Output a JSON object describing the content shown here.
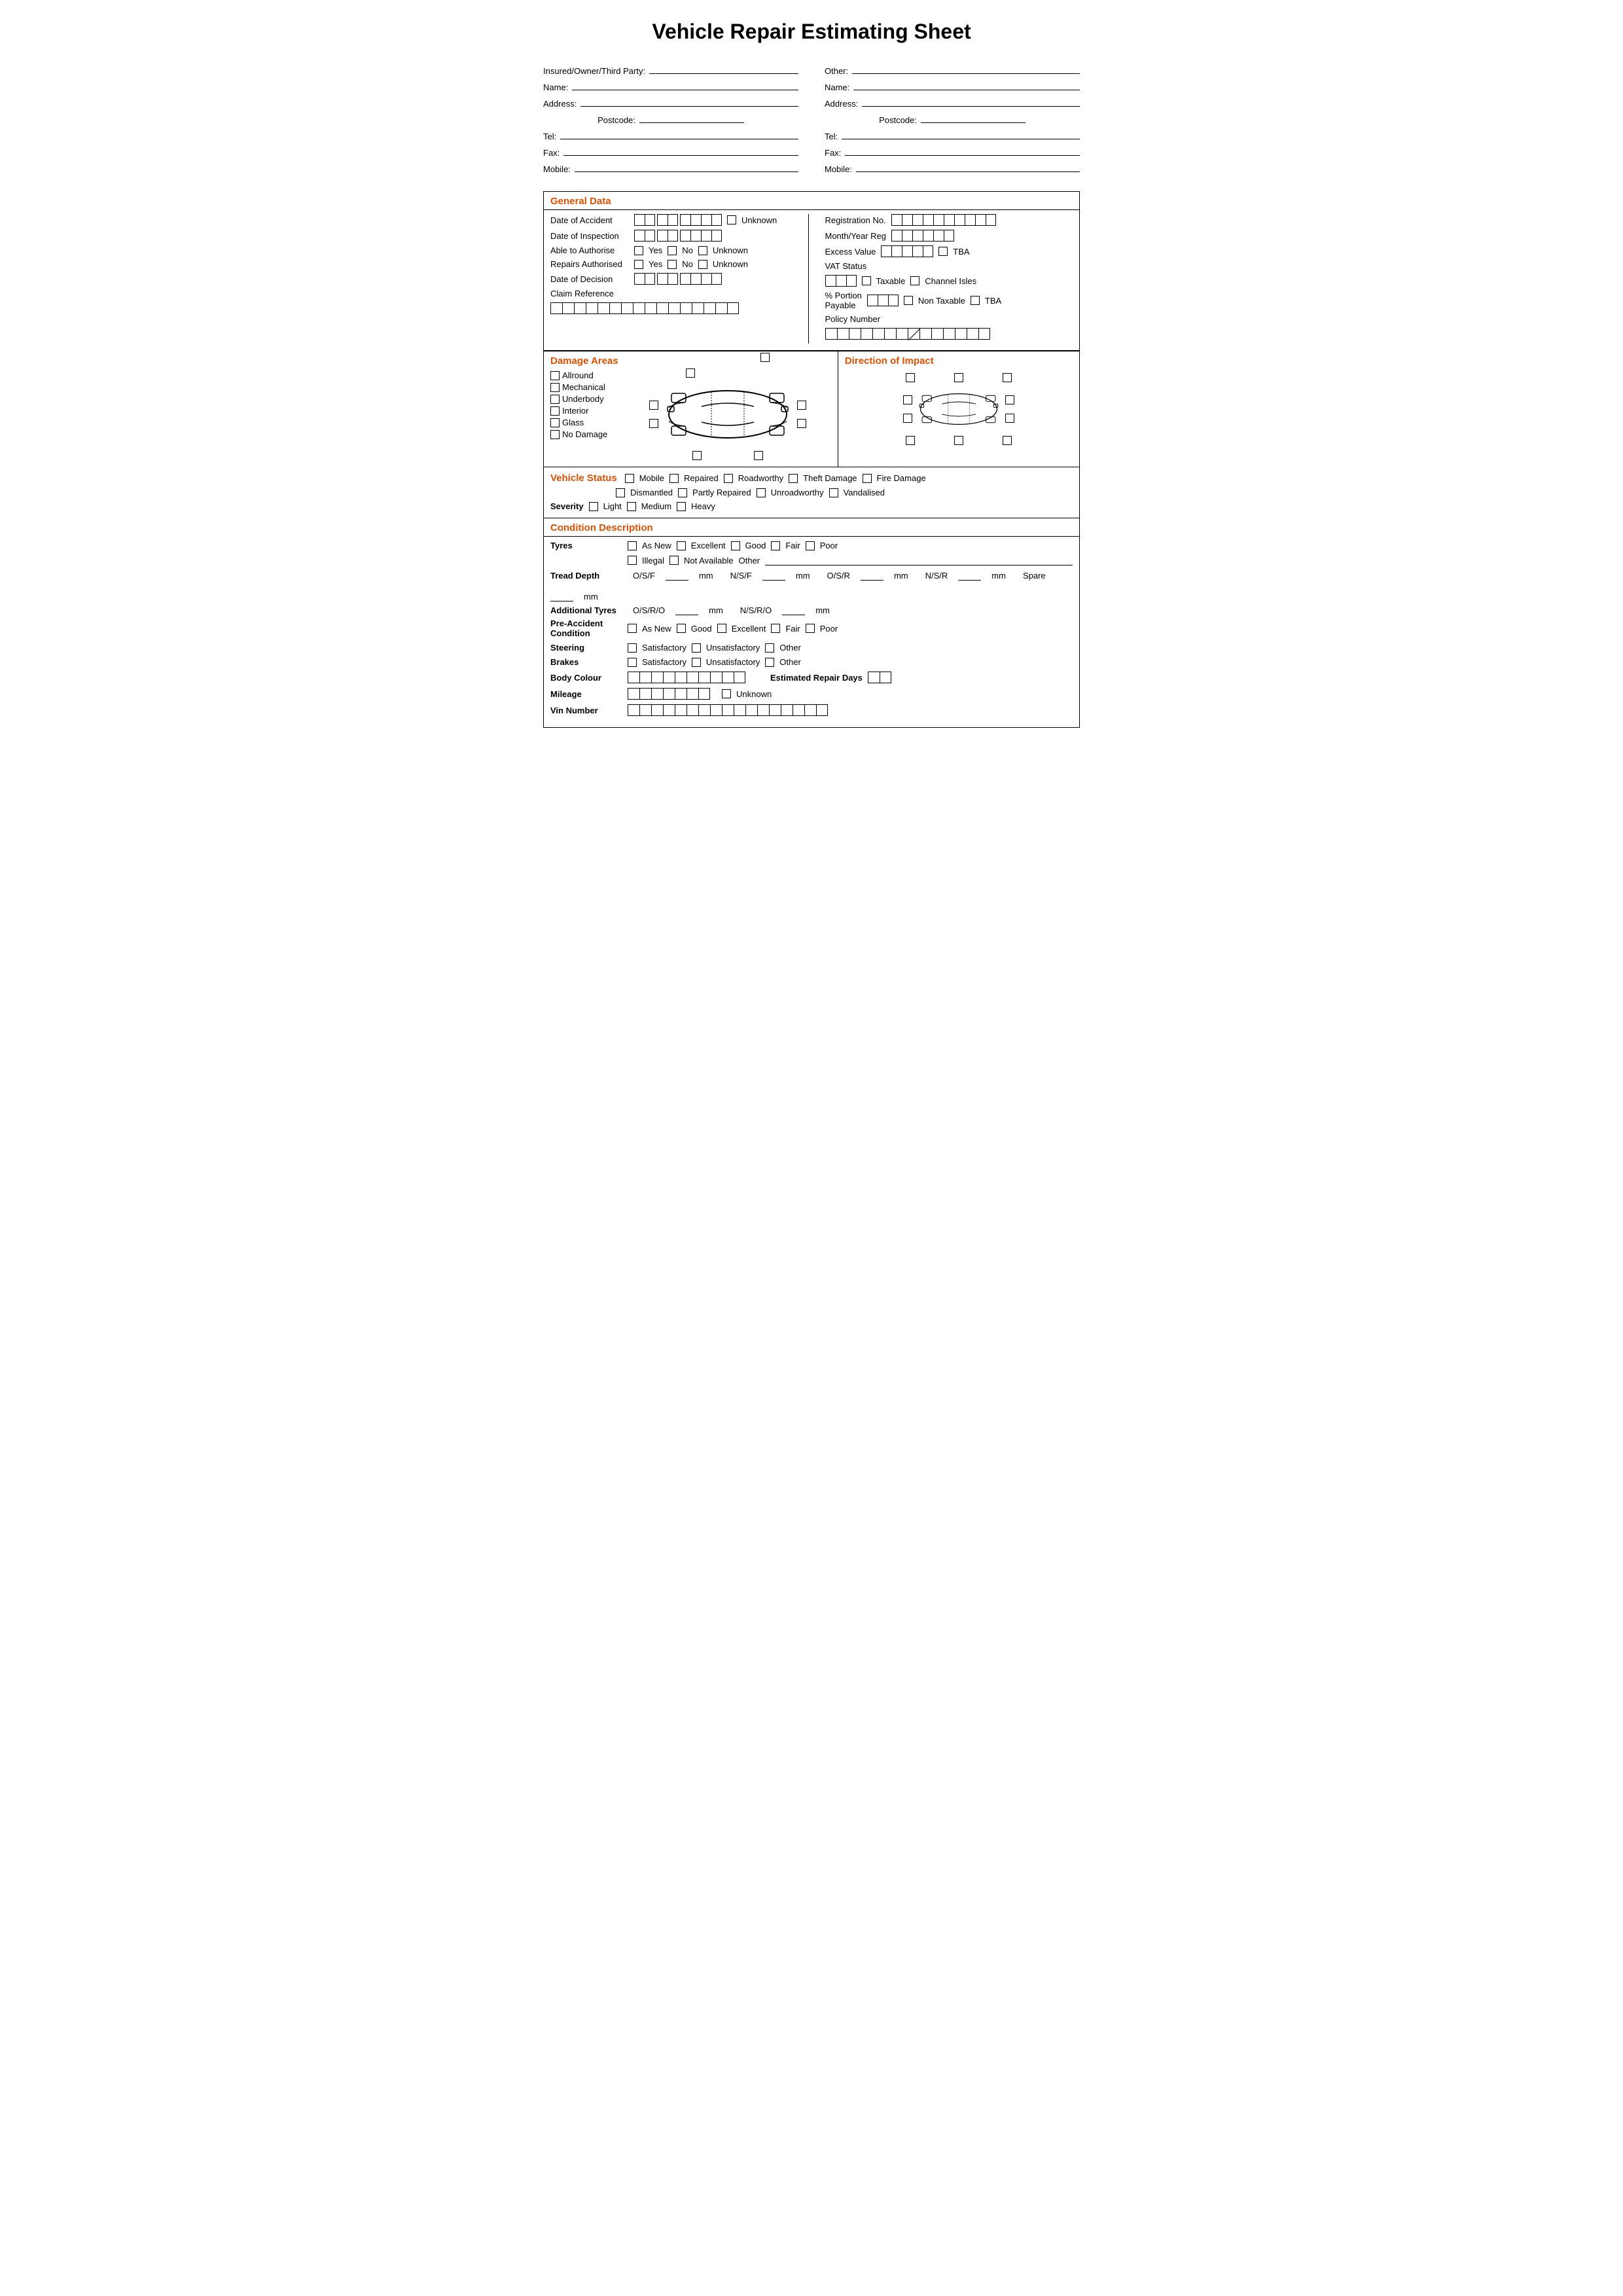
{
  "title": "Vehicle Repair Estimating Sheet",
  "left_column": {
    "label": "Insured/Owner/Third Party:",
    "fields": [
      {
        "label": "Name:",
        "id": "left-name"
      },
      {
        "label": "Address:",
        "id": "left-address"
      },
      {
        "label": "Postcode:",
        "id": "left-postcode"
      },
      {
        "label": "Tel:",
        "id": "left-tel"
      },
      {
        "label": "Fax:",
        "id": "left-fax"
      },
      {
        "label": "Mobile:",
        "id": "left-mobile"
      }
    ]
  },
  "right_column": {
    "label": "Other:",
    "fields": [
      {
        "label": "Name:",
        "id": "right-name"
      },
      {
        "label": "Address:",
        "id": "right-address"
      },
      {
        "label": "Postcode:",
        "id": "right-postcode"
      },
      {
        "label": "Tel:",
        "id": "right-tel"
      },
      {
        "label": "Fax:",
        "id": "right-fax"
      },
      {
        "label": "Mobile:",
        "id": "right-mobile"
      }
    ]
  },
  "sections": {
    "general_data": {
      "header": "General Data",
      "left": {
        "rows": [
          {
            "label": "Date of Accident",
            "boxes": 9,
            "extra": [
              {
                "type": "cb+label",
                "label": "Unknown"
              }
            ]
          },
          {
            "label": "Date of Inspection",
            "boxes": 7
          },
          {
            "label": "Able to Authorise",
            "options": [
              "Yes",
              "No",
              "Unknown"
            ]
          },
          {
            "label": "Repairs Authorised",
            "options": [
              "Yes",
              "No",
              "Unknown"
            ]
          },
          {
            "label": "Date of Decision",
            "boxes": 7
          },
          {
            "label": "Claim Reference",
            "boxes_wide": 16
          }
        ]
      },
      "right": {
        "rows": [
          {
            "label": "Registration No.",
            "boxes": 10
          },
          {
            "label": "Month/Year Reg",
            "boxes": 6
          },
          {
            "label": "Excess Value",
            "boxes": 5,
            "extra_label": "TBA"
          },
          {
            "label": "VAT Status"
          },
          {
            "label": "vat_options",
            "options_inline": true
          },
          {
            "label": "% Portion Payable",
            "boxes": 3,
            "options_inline2": true
          },
          {
            "label": "Policy Number",
            "boxes_wide": 14
          }
        ]
      }
    },
    "damage_areas": {
      "header": "Damage Areas",
      "checkboxes": [
        "Allround",
        "Mechanical",
        "Underbody",
        "Interior",
        "Glass",
        "No Damage"
      ]
    },
    "direction_of_impact": {
      "header": "Direction of Impact"
    },
    "vehicle_status": {
      "header": "Vehicle Status",
      "row1": [
        "Mobile",
        "Repaired",
        "Roadworthy",
        "Theft Damage",
        "Fire Damage"
      ],
      "row2": [
        "Dismantled",
        "Partly Repaired",
        "Unroadworthy",
        "Vandalised"
      ],
      "severity": [
        "Light",
        "Medium",
        "Heavy"
      ]
    },
    "condition_description": {
      "header": "Condition Description",
      "tyres_row1": [
        "As New",
        "Excellent",
        "Good",
        "Fair",
        "Poor"
      ],
      "tyres_row2": [
        "Illegal",
        "Not Available"
      ],
      "tread_depth": {
        "label": "Tread Depth",
        "fields": [
          "O/S/F",
          "N/S/F",
          "O/S/R",
          "N/S/R",
          "Spare"
        ]
      },
      "additional_tyres": {
        "label": "Additional Tyres",
        "fields": [
          "O/S/R/O",
          "N/S/R/O"
        ]
      },
      "pre_accident": {
        "label": "Pre-Accident Condition",
        "options": [
          "As New",
          "Good",
          "Excellent",
          "Fair",
          "Poor"
        ]
      },
      "steering": {
        "label": "Steering",
        "options": [
          "Satisfactory",
          "Unsatisfactory",
          "Other"
        ]
      },
      "brakes": {
        "label": "Brakes",
        "options": [
          "Satisfactory",
          "Unsatisfactory",
          "Other"
        ]
      },
      "body_colour": {
        "label": "Body Colour",
        "boxes": 10,
        "estimated_repair_days": "Estimated Repair Days"
      },
      "mileage": {
        "label": "Mileage",
        "boxes": 7,
        "extra": "Unknown"
      },
      "vin_number": {
        "label": "Vin Number",
        "boxes": 17
      }
    }
  }
}
